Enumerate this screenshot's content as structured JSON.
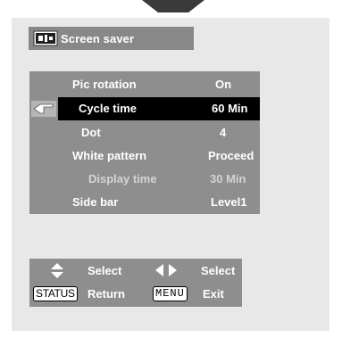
{
  "title": "Screen saver",
  "menu": {
    "rows": [
      {
        "label": "Pic rotation",
        "value": "On"
      },
      {
        "label": "Cycle time",
        "value": "60 Min"
      },
      {
        "label": "Dot",
        "value": "4"
      },
      {
        "label": "White pattern",
        "value": "Proceed"
      },
      {
        "label": "Display time",
        "value": "30 Min"
      },
      {
        "label": "Side bar",
        "value": "Level1"
      }
    ]
  },
  "help": {
    "select1": "Select",
    "select2": "Select",
    "status_key": "STATUS",
    "return": "Return",
    "menu_key": "MENU",
    "exit": "Exit"
  }
}
